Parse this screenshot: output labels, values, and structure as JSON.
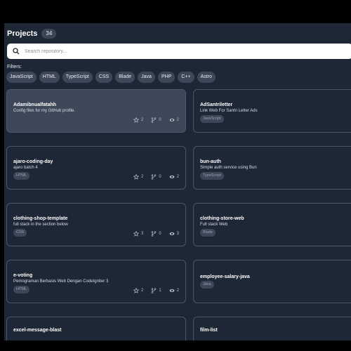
{
  "header": {
    "title": "Projects",
    "count": "34"
  },
  "search": {
    "placeholder": "Search repository..."
  },
  "filters": {
    "label": "Filters:",
    "chips": [
      "JavaScript",
      "HTML",
      "TypeScript",
      "CSS",
      "Blade",
      "Java",
      "PHP",
      "C++",
      "Astro"
    ]
  },
  "projects": [
    {
      "name": "Adamibnualfatahh",
      "description": "Config files for my GitHub profile.",
      "language": "",
      "stars": "2",
      "forks": "0",
      "watchers": "2"
    },
    {
      "name": "AdSantriletter",
      "description": "Link Web For Santri Letter Ads",
      "language": "JavaScript",
      "stars": "2",
      "forks": "",
      "watchers": ""
    },
    {
      "name": "ajaro-coding-day",
      "description": "ajaro batch 4",
      "language": "HTML",
      "stars": "2",
      "forks": "0",
      "watchers": "2"
    },
    {
      "name": "bun-auth",
      "description": "Simple auth service using Bun",
      "language": "TypeScript",
      "stars": "1",
      "forks": "",
      "watchers": ""
    },
    {
      "name": "clothing-shop-template",
      "description": "full stack in the section below",
      "language": "CSS",
      "stars": "3",
      "forks": "0",
      "watchers": "3"
    },
    {
      "name": "clothing-store-web",
      "description": "Full stack Web",
      "language": "Blade",
      "stars": "",
      "forks": "",
      "watchers": ""
    },
    {
      "name": "e-voting",
      "description": "Pemograman Berbasis Web Dengan CodeIgniter 3",
      "language": "HTML",
      "stars": "2",
      "forks": "1",
      "watchers": "2"
    },
    {
      "name": "employee-salary-java",
      "description": "",
      "language": "Java",
      "stars": "2",
      "forks": "",
      "watchers": ""
    },
    {
      "name": "excel-message-blast",
      "description": "",
      "language": "",
      "stars": "",
      "forks": "",
      "watchers": ""
    },
    {
      "name": "film-list",
      "description": "",
      "language": "",
      "stars": "",
      "forks": "",
      "watchers": ""
    }
  ]
}
